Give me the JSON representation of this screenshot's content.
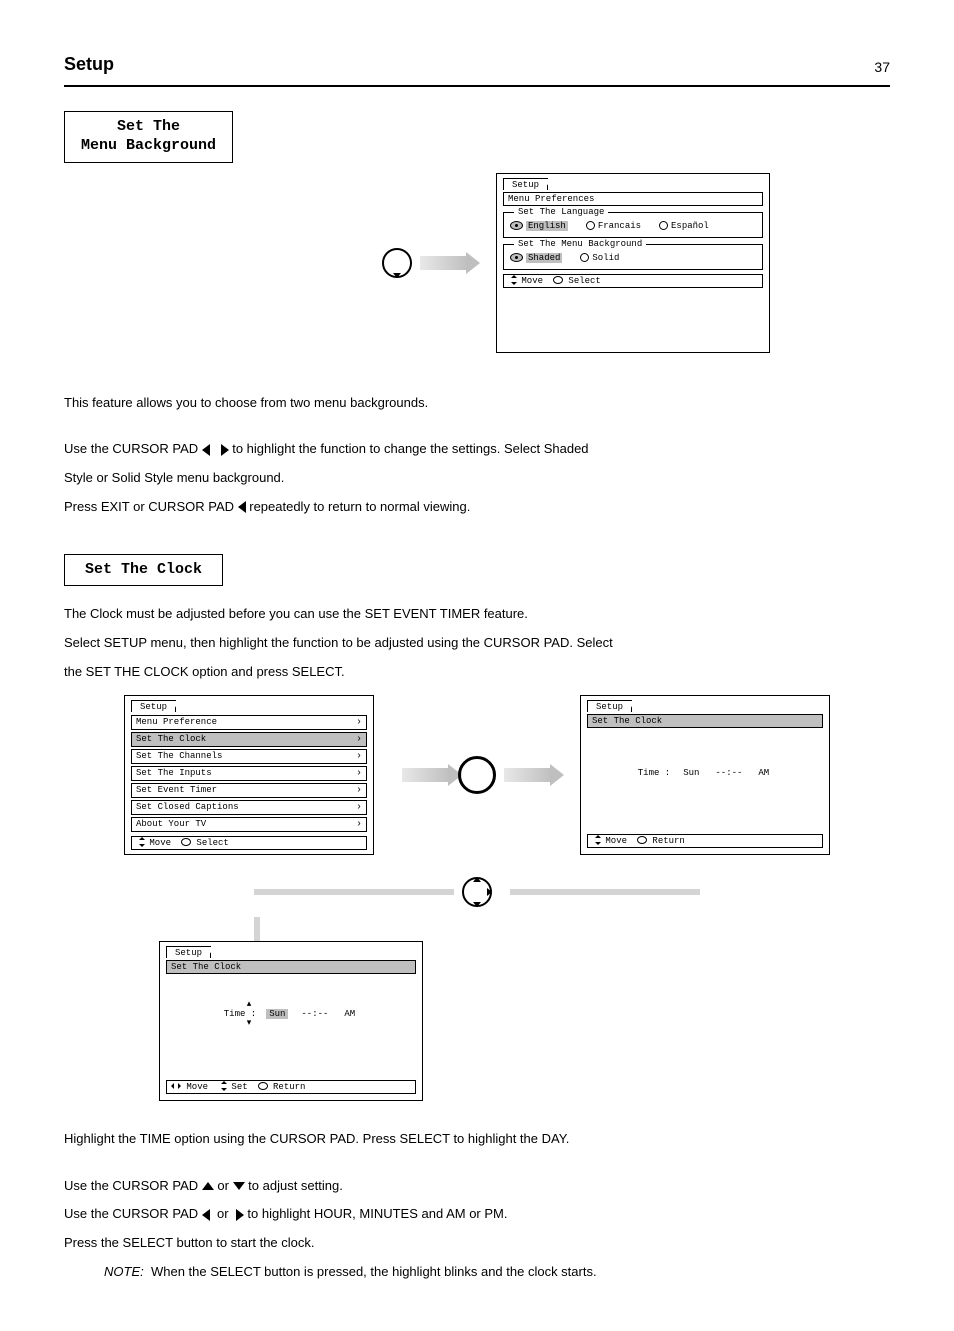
{
  "header": {
    "title": "Setup",
    "page_number": "37"
  },
  "section_a": {
    "heading_line1": "Set The",
    "heading_line2": "Menu Background",
    "osd": {
      "tab_primary": "Setup",
      "tab_sub": "Menu Preferences",
      "language": {
        "legend": "Set The Language",
        "opt1": "English",
        "opt2": "Francais",
        "opt3": "Español"
      },
      "background": {
        "legend": "Set The Menu Background",
        "opt1": "Shaded",
        "opt2": "Solid"
      },
      "hint_move": "Move",
      "hint_select": "Select"
    },
    "text": {
      "p1": "This feature allows you to choose from two menu backgrounds.",
      "p2a": "Use the CURSOR PAD ",
      "p2b": " to highlight the function to change the settings. Select Shaded",
      "p3": "Style or Solid Style menu background.",
      "p4a": "Press EXIT or CURSOR PAD ",
      "p4b": " repeatedly to return to normal viewing."
    }
  },
  "section_b": {
    "heading": "Set The Clock",
    "intro1": "The Clock must be adjusted before you can use the SET EVENT TIMER feature.",
    "intro2a": "Select SETUP menu, then highlight the function to be adjusted using the CURSOR PAD. Select",
    "intro2b": "the SET THE CLOCK option and press SELECT.",
    "osd_menu": {
      "tab_primary": "Setup",
      "tab_sub": "Menu Preference",
      "items": [
        "Menu Preference",
        "Set The Clock",
        "Set The Channels",
        "Set The Inputs",
        "Set Event Timer",
        "Set Closed Captions",
        "About Your TV"
      ],
      "hint_move": "Move",
      "hint_select": "Select"
    },
    "osd_clock1": {
      "tab_primary": "Setup",
      "tab_sub": "Set The Clock",
      "time_label": "Time :",
      "day": "Sun",
      "time": "--:--",
      "ampm": "AM",
      "hint_move": "Move",
      "hint_return": "Return"
    },
    "osd_clock2": {
      "tab_primary": "Setup",
      "tab_sub": "Set The Clock",
      "time_label": "Time :",
      "day": "Sun",
      "time": "--:--",
      "ampm": "AM",
      "hint_move": "Move",
      "hint_set": "Set",
      "hint_return": "Return"
    },
    "instr": {
      "lead": "Highlight the TIME option using the CURSOR PAD. Press SELECT to highlight the DAY.",
      "l1a": "Use the CURSOR PAD  ",
      "l1b": "  or  ",
      "l1c": "  to adjust setting.",
      "l2a": "Use the CURSOR PAD  ",
      "l2b": "  to highlight HOUR, MINUTES and AM or PM.",
      "l3": "Press the SELECT button to start the clock.",
      "note_label": "NOTE:",
      "note_body": "When the SELECT button is pressed, the highlight blinks and the clock starts."
    }
  }
}
